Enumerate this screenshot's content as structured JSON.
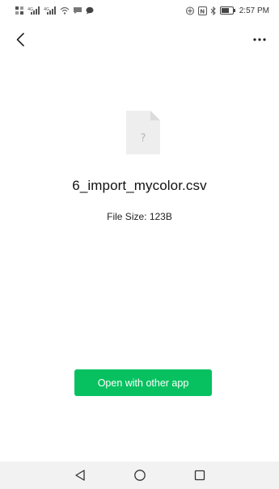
{
  "status_bar": {
    "time": "2:57 PM",
    "icons": [
      "sim-icon",
      "signal-icon",
      "signal-icon",
      "wifi-icon",
      "message-icon",
      "nfc-icon",
      "bluetooth-icon",
      "battery-icon"
    ]
  },
  "app_bar": {
    "back_icon": "back-arrow-icon",
    "more_icon": "more-options-icon"
  },
  "file": {
    "icon": "unknown-file-icon",
    "icon_glyph": "?",
    "name": "6_import_mycolor.csv",
    "size_text": "File Size: 123B"
  },
  "actions": {
    "open_label": "Open with other app"
  },
  "nav_bar": {
    "back_icon": "nav-back-icon",
    "home_icon": "nav-home-icon",
    "recents_icon": "nav-recents-icon"
  },
  "colors": {
    "accent": "#07c160",
    "nav_background": "#f2f2f2",
    "file_icon_fill": "#eeeeee"
  }
}
